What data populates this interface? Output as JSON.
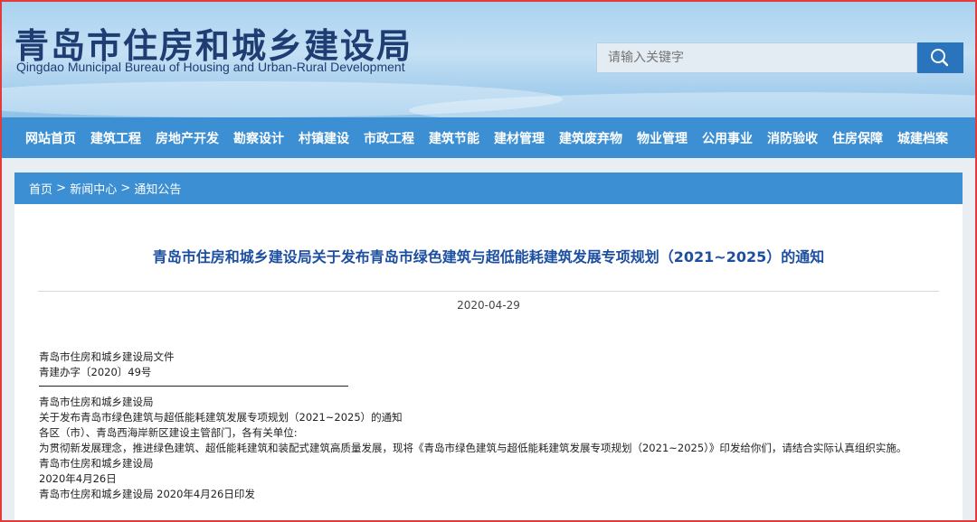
{
  "site": {
    "title": "青岛市住房和城乡建设局",
    "subtitle": "Qingdao Municipal Bureau of Housing and Urban-Rural Development"
  },
  "search": {
    "placeholder": "请输入关键字"
  },
  "nav": {
    "items": [
      "网站首页",
      "建筑工程",
      "房地产开发",
      "勘察设计",
      "村镇建设",
      "市政工程",
      "建筑节能",
      "建材管理",
      "建筑废弃物",
      "物业管理",
      "公用事业",
      "消防验收",
      "住房保障",
      "城建档案"
    ]
  },
  "breadcrumb": {
    "home": "首页",
    "sep": " > ",
    "news": "新闻中心",
    "notice": "通知公告"
  },
  "article": {
    "title": "青岛市住房和城乡建设局关于发布青岛市绿色建筑与超低能耗建筑发展专项规划（2021~2025）的通知",
    "date": "2020-04-29",
    "header_lines": [
      "青岛市住房和城乡建设局文件",
      "青建办字〔2020〕49号"
    ],
    "body_lines": [
      "青岛市住房和城乡建设局",
      "关于发布青岛市绿色建筑与超低能耗建筑发展专项规划（2021~2025）的通知",
      "各区（市）、青岛西海岸新区建设主管部门，各有关单位:",
      "为贯彻新发展理念，推进绿色建筑、超低能耗建筑和装配式建筑高质量发展，现将《青岛市绿色建筑与超低能耗建筑发展专项规划（2021~2025）》印发给你们，请结合实际认真组织实施。",
      "青岛市住房和城乡建设局",
      "2020年4月26日",
      "青岛市住房和城乡建设局 2020年4月26日印发"
    ]
  },
  "colors": {
    "nav_bg": "#3c8fd3",
    "title_color": "#1d4fa0",
    "search_btn": "#2a74bd",
    "frame_border": "#e23b3b"
  }
}
